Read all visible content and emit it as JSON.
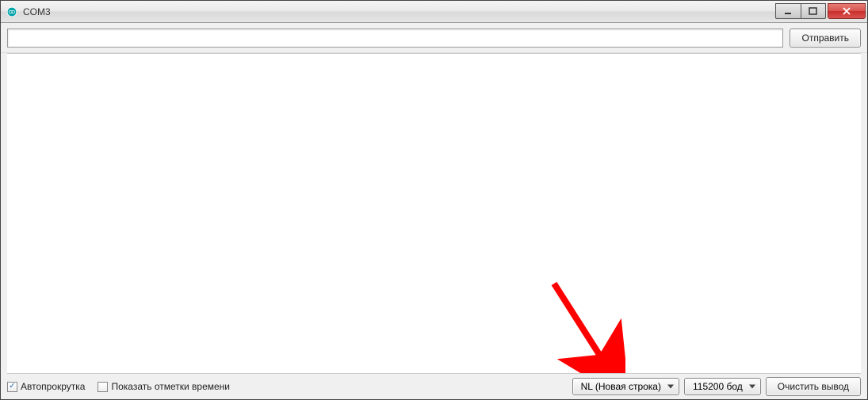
{
  "window": {
    "title": "COM3"
  },
  "toolbar": {
    "input_value": "",
    "send_label": "Отправить"
  },
  "output": {
    "text": ""
  },
  "statusbar": {
    "autoscroll_label": "Автопрокрутка",
    "autoscroll_checked": true,
    "timestamp_label": "Показать отметки времени",
    "timestamp_checked": false,
    "line_ending_selected": "NL (Новая строка)",
    "baud_selected": "115200 бод",
    "clear_label": "Очистить вывод"
  },
  "annotation": {
    "type": "arrow",
    "color": "#ff0000"
  }
}
